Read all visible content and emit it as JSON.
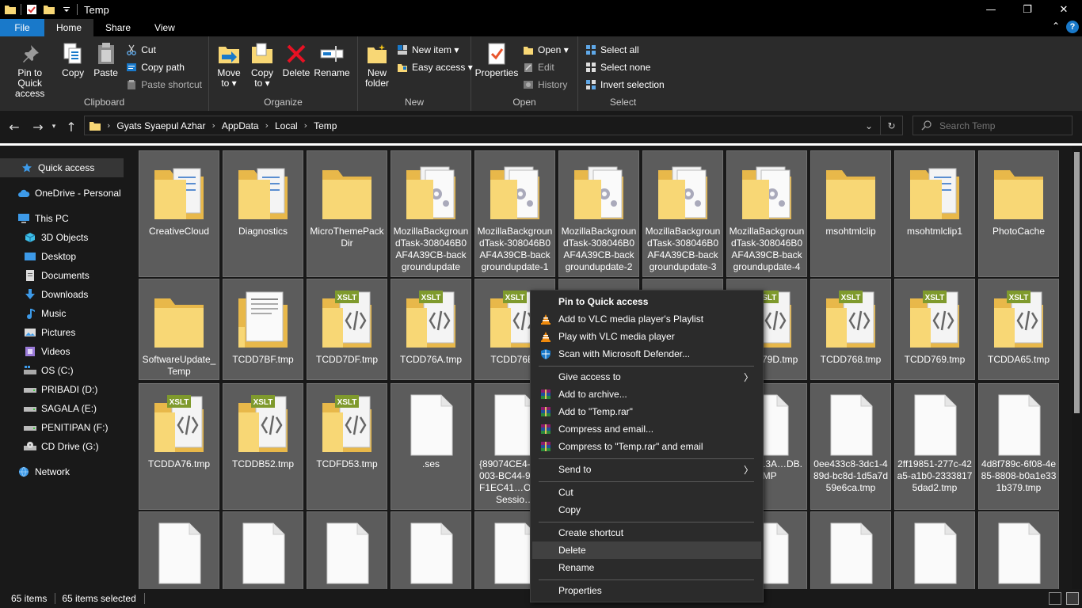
{
  "window": {
    "title": "Temp",
    "minimize": "—",
    "maximize": "❐",
    "close": "✕"
  },
  "tabs": {
    "file": "File",
    "home": "Home",
    "share": "Share",
    "view": "View",
    "collapse": "⌃",
    "help": "?"
  },
  "ribbon": {
    "clipboard": {
      "label": "Clipboard",
      "pin": "Pin to Quick\naccess",
      "copy": "Copy",
      "paste": "Paste",
      "cut": "Cut",
      "copy_path": "Copy path",
      "paste_shortcut": "Paste shortcut"
    },
    "organize": {
      "label": "Organize",
      "move_to": "Move\nto ▾",
      "copy_to": "Copy\nto ▾",
      "delete": "Delete",
      "rename": "Rename"
    },
    "new": {
      "label": "New",
      "new_folder": "New\nfolder",
      "new_item": "New item ▾",
      "easy_access": "Easy access ▾"
    },
    "open": {
      "label": "Open",
      "properties": "Properties",
      "open": "Open ▾",
      "edit": "Edit",
      "history": "History"
    },
    "select": {
      "label": "Select",
      "select_all": "Select all",
      "select_none": "Select none",
      "invert_selection": "Invert selection"
    }
  },
  "address": {
    "crumbs": [
      "Gyats Syaepul Azhar",
      "AppData",
      "Local",
      "Temp"
    ],
    "search_placeholder": "Search Temp"
  },
  "nav": {
    "quick_access": "Quick access",
    "onedrive": "OneDrive - Personal",
    "this_pc": "This PC",
    "objects3d": "3D Objects",
    "desktop": "Desktop",
    "documents": "Documents",
    "downloads": "Downloads",
    "music": "Music",
    "pictures": "Pictures",
    "videos": "Videos",
    "os_c": "OS (C:)",
    "pribadi_d": "PRIBADI (D:)",
    "sagala_e": "SAGALA (E:)",
    "penitipan_f": "PENITIPAN (F:)",
    "cd_g": "CD Drive (G:)",
    "network": "Network"
  },
  "files": [
    {
      "name": "CreativeCloud",
      "type": "folder-docs"
    },
    {
      "name": "Diagnostics",
      "type": "folder-docs"
    },
    {
      "name": "MicroThemePackDir",
      "type": "folder"
    },
    {
      "name": "MozillaBackgroundTask-308046B0AF4A39CB-backgroundupdate",
      "type": "folder-gear"
    },
    {
      "name": "MozillaBackgroundTask-308046B0AF4A39CB-backgroundupdate-1",
      "type": "folder-gear"
    },
    {
      "name": "MozillaBackgroundTask-308046B0AF4A39CB-backgroundupdate-2",
      "type": "folder-gear"
    },
    {
      "name": "MozillaBackgroundTask-308046B0AF4A39CB-backgroundupdate-3",
      "type": "folder-gear"
    },
    {
      "name": "MozillaBackgroundTask-308046B0AF4A39CB-backgroundupdate-4",
      "type": "folder-gear"
    },
    {
      "name": "msohtmlclip",
      "type": "folder"
    },
    {
      "name": "msohtmlclip1",
      "type": "folder-docs"
    },
    {
      "name": "PhotoCache",
      "type": "folder"
    },
    {
      "name": "SoftwareUpdate_Temp",
      "type": "folder"
    },
    {
      "name": "TCDD7BF.tmp",
      "type": "folder-paper"
    },
    {
      "name": "TCDD7DF.tmp",
      "type": "folder-xslt"
    },
    {
      "name": "TCDD76A.tmp",
      "type": "folder-xslt"
    },
    {
      "name": "TCDD76B.t",
      "type": "folder-xslt"
    },
    {
      "name": "TCDD79D.tmp",
      "type": "folder-xslt"
    },
    {
      "name": "TCDD768.tmp",
      "type": "folder-xslt"
    },
    {
      "name": "TCDD769.tmp",
      "type": "folder-xslt"
    },
    {
      "name": "TCDDA65.tmp",
      "type": "folder-xslt"
    },
    {
      "name": "TCDDA76.tmp",
      "type": "folder-xslt"
    },
    {
      "name": "TCDDB52.tmp",
      "type": "folder-xslt"
    },
    {
      "name": "TCDFD53.tmp",
      "type": "folder-xslt"
    },
    {
      "name": ".ses",
      "type": "file"
    },
    {
      "name": "{89074CE4-1…4003-BC44-9…25F1EC41…OProcSessio…",
      "type": "file"
    },
    {
      "name": "0A23D13A…DB.TMP",
      "type": "file"
    },
    {
      "name": "0ee433c8-3dc1-489d-bc8d-1d5a7d59e6ca.tmp",
      "type": "file"
    },
    {
      "name": "2ff19851-277c-42a5-a1b0-23338175dad2.tmp",
      "type": "file"
    },
    {
      "name": "4d8f789c-6f08-4e85-8808-b0a1e331b379.tmp",
      "type": "file"
    }
  ],
  "context_menu": {
    "pin": "Pin to Quick access",
    "vlc_playlist": "Add to VLC media player's Playlist",
    "vlc_play": "Play with VLC media player",
    "defender": "Scan with Microsoft Defender...",
    "give_access": "Give access to",
    "add_archive": "Add to archive...",
    "add_temp_rar": "Add to \"Temp.rar\"",
    "compress_email": "Compress and email...",
    "compress_temp_email": "Compress to \"Temp.rar\" and email",
    "send_to": "Send to",
    "cut": "Cut",
    "copy": "Copy",
    "create_shortcut": "Create shortcut",
    "delete": "Delete",
    "rename": "Rename",
    "properties": "Properties"
  },
  "status": {
    "count": "65 items",
    "selected": "65 items selected"
  },
  "colors": {
    "accent": "#1979ca",
    "folder": "#f8d775",
    "folder_dark": "#e8b84a",
    "tile_selected": "#5c5c5c",
    "xslt_green": "#7f9a2d"
  }
}
